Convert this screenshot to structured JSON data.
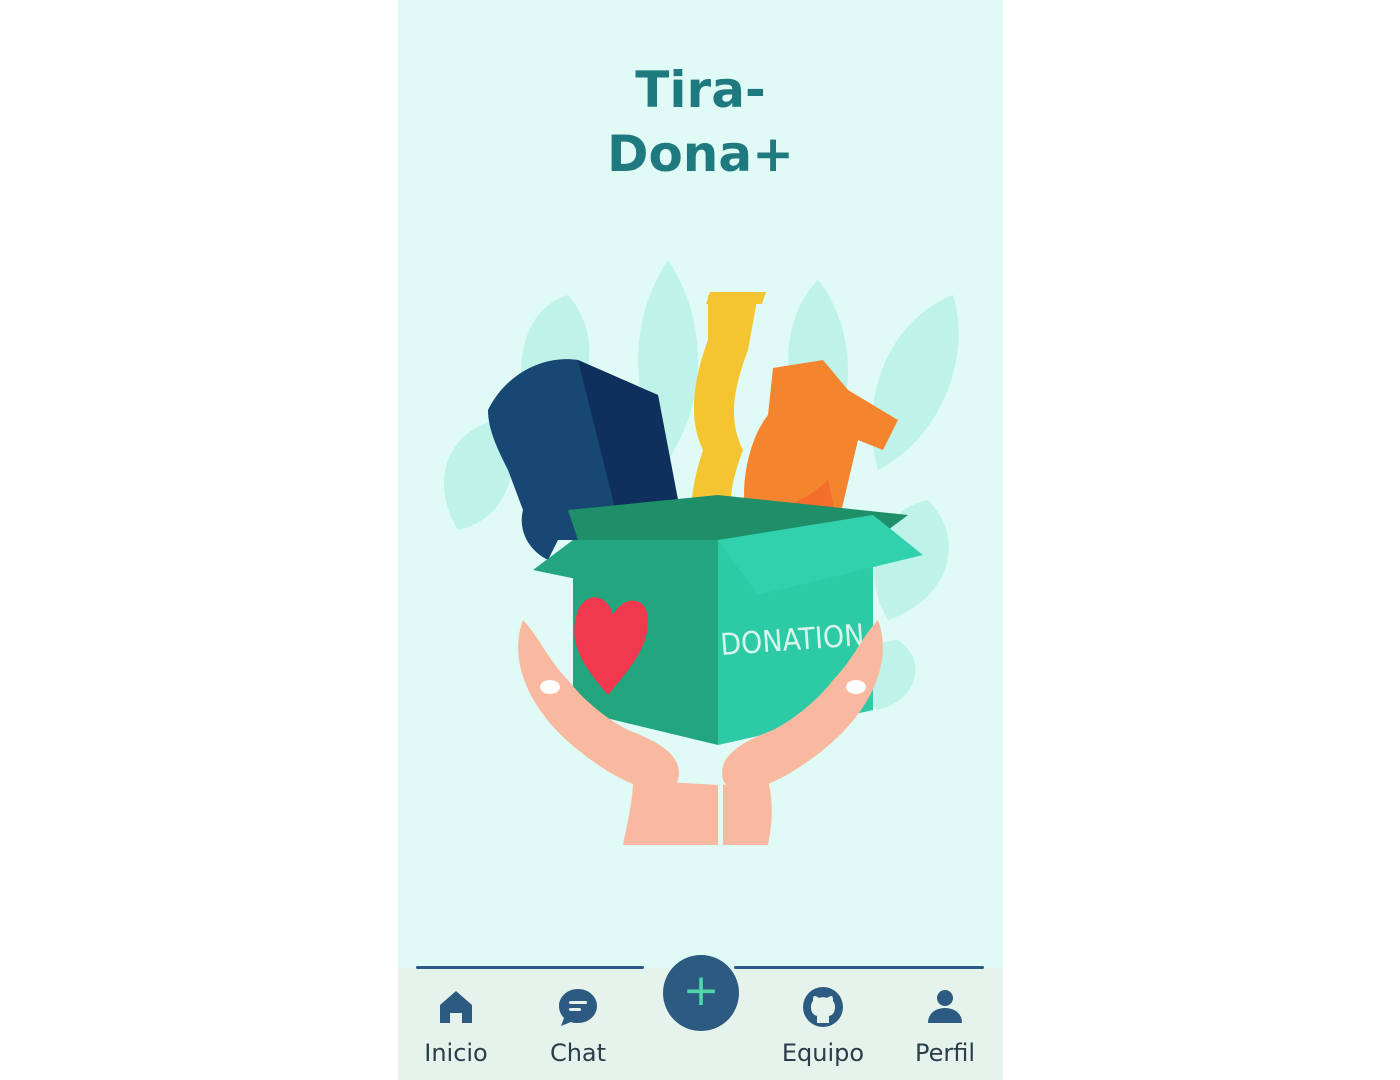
{
  "app": {
    "title_line1": "Tira-",
    "title_line2": "Dona+"
  },
  "hero": {
    "box_label": "DONATION"
  },
  "nav": {
    "items": [
      {
        "label": "Inicio",
        "icon": "home-icon"
      },
      {
        "label": "Chat",
        "icon": "chat-icon"
      },
      {
        "label": "Equipo",
        "icon": "github-icon"
      },
      {
        "label": "Perfil",
        "icon": "user-icon"
      }
    ],
    "fab_symbol": "+"
  },
  "colors": {
    "background": "#e0faf5",
    "title": "#1f7a80",
    "nav_bg": "#e6f3ec",
    "nav_icon": "#2d5a80",
    "fab_plus": "#4fd6a9"
  }
}
